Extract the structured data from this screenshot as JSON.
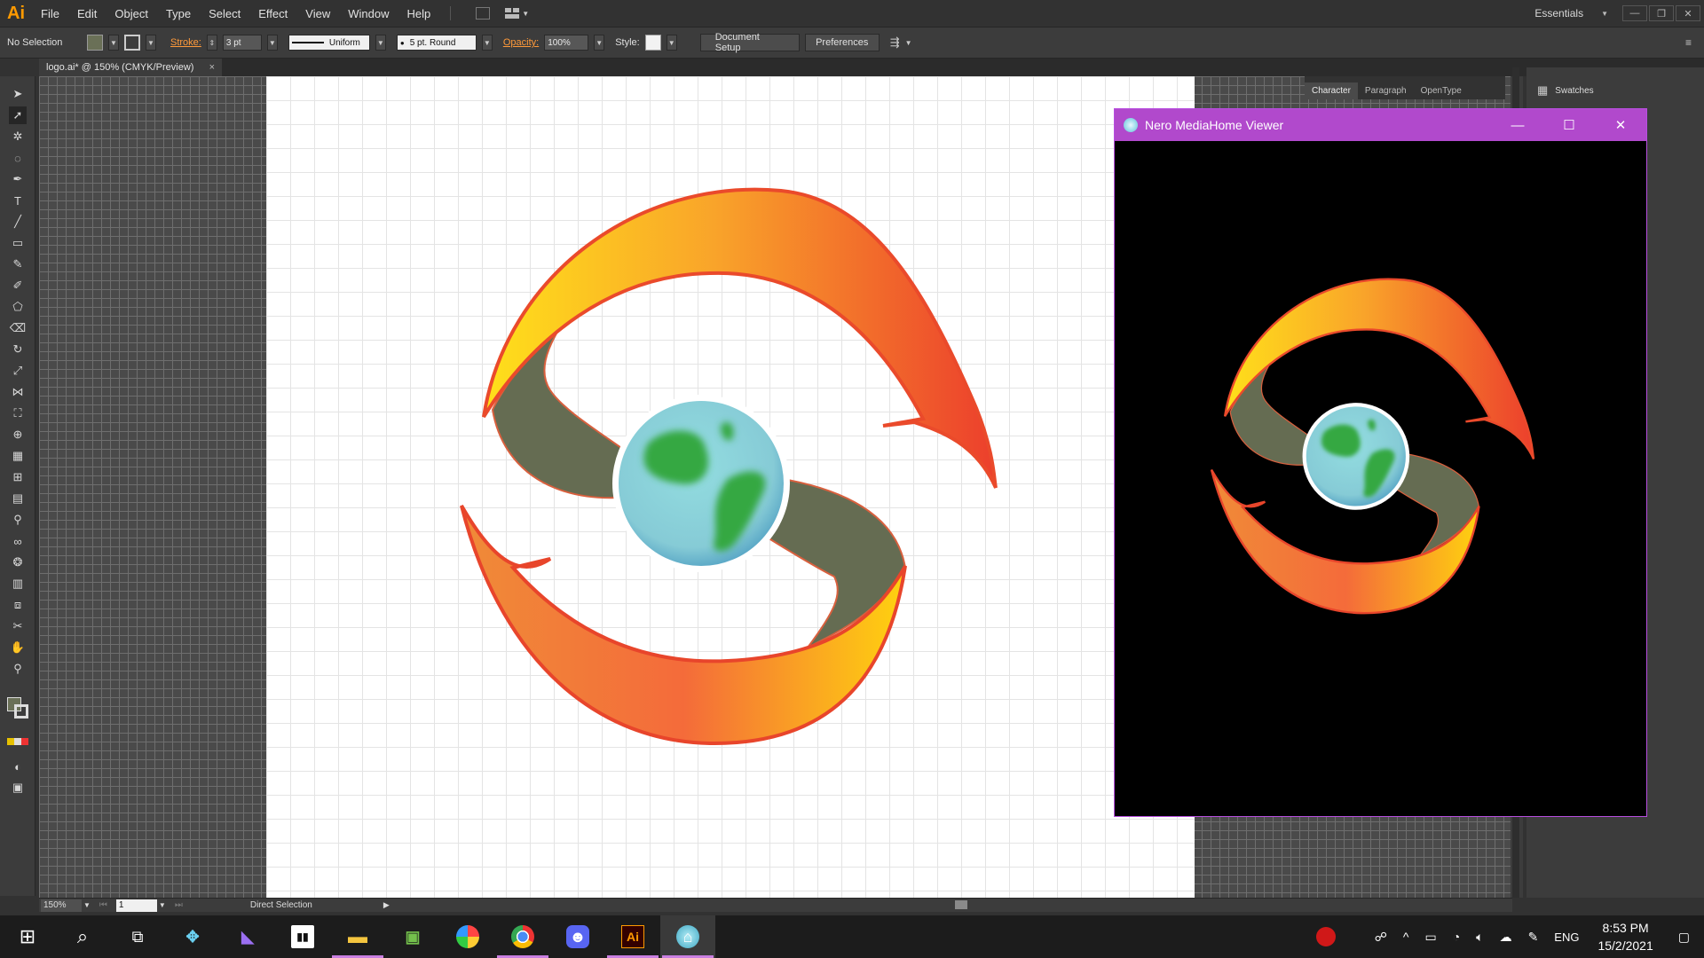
{
  "app": {
    "logo": "Ai",
    "menus": [
      "File",
      "Edit",
      "Object",
      "Type",
      "Select",
      "Effect",
      "View",
      "Window",
      "Help"
    ],
    "workspace": "Essentials",
    "window_controls": [
      "—",
      "❐",
      "✕"
    ]
  },
  "control_bar": {
    "selection": "No Selection",
    "stroke_label": "Stroke:",
    "stroke_value": "3 pt",
    "profile": "Uniform",
    "brush": "5 pt. Round",
    "opacity_label": "Opacity:",
    "opacity_value": "100%",
    "style_label": "Style:",
    "document_setup": "Document Setup",
    "preferences": "Preferences"
  },
  "document": {
    "tab_title": "logo.ai* @ 150% (CMYK/Preview)",
    "close": "×"
  },
  "panels": {
    "character_tabs": [
      "Character",
      "Paragraph",
      "OpenType"
    ],
    "swatches": "Swatches"
  },
  "status_bar": {
    "zoom": "150%",
    "page": "1",
    "tool": "Direct Selection"
  },
  "nero_window": {
    "title": "Nero MediaHome Viewer",
    "controls": [
      "—",
      "☐",
      "✕"
    ]
  },
  "taskbar": {
    "apps": [
      {
        "name": "start",
        "glyph": "⊞"
      },
      {
        "name": "search",
        "glyph": "⌕"
      },
      {
        "name": "task-view",
        "glyph": "⧉"
      },
      {
        "name": "game-app",
        "glyph": "✥"
      },
      {
        "name": "visual-studio",
        "glyph": "◣"
      },
      {
        "name": "media-app",
        "glyph": "▮▮"
      },
      {
        "name": "file-explorer",
        "glyph": "▬"
      },
      {
        "name": "photos",
        "glyph": "▣"
      },
      {
        "name": "paint",
        "glyph": "◕"
      },
      {
        "name": "chrome",
        "glyph": "◉"
      },
      {
        "name": "discord",
        "glyph": "☻"
      },
      {
        "name": "illustrator",
        "glyph": "Ai"
      },
      {
        "name": "nero-mediahome",
        "glyph": "⌂"
      }
    ],
    "language": "ENG",
    "time": "8:53 PM",
    "date": "15/2/2021"
  },
  "colors": {
    "nero_titlebar": "#b149cc",
    "accent_orange": "#ff9a00",
    "globe_ocean": "#7fd0d8",
    "globe_land": "#3aa845",
    "band_gray": "#656c52"
  }
}
